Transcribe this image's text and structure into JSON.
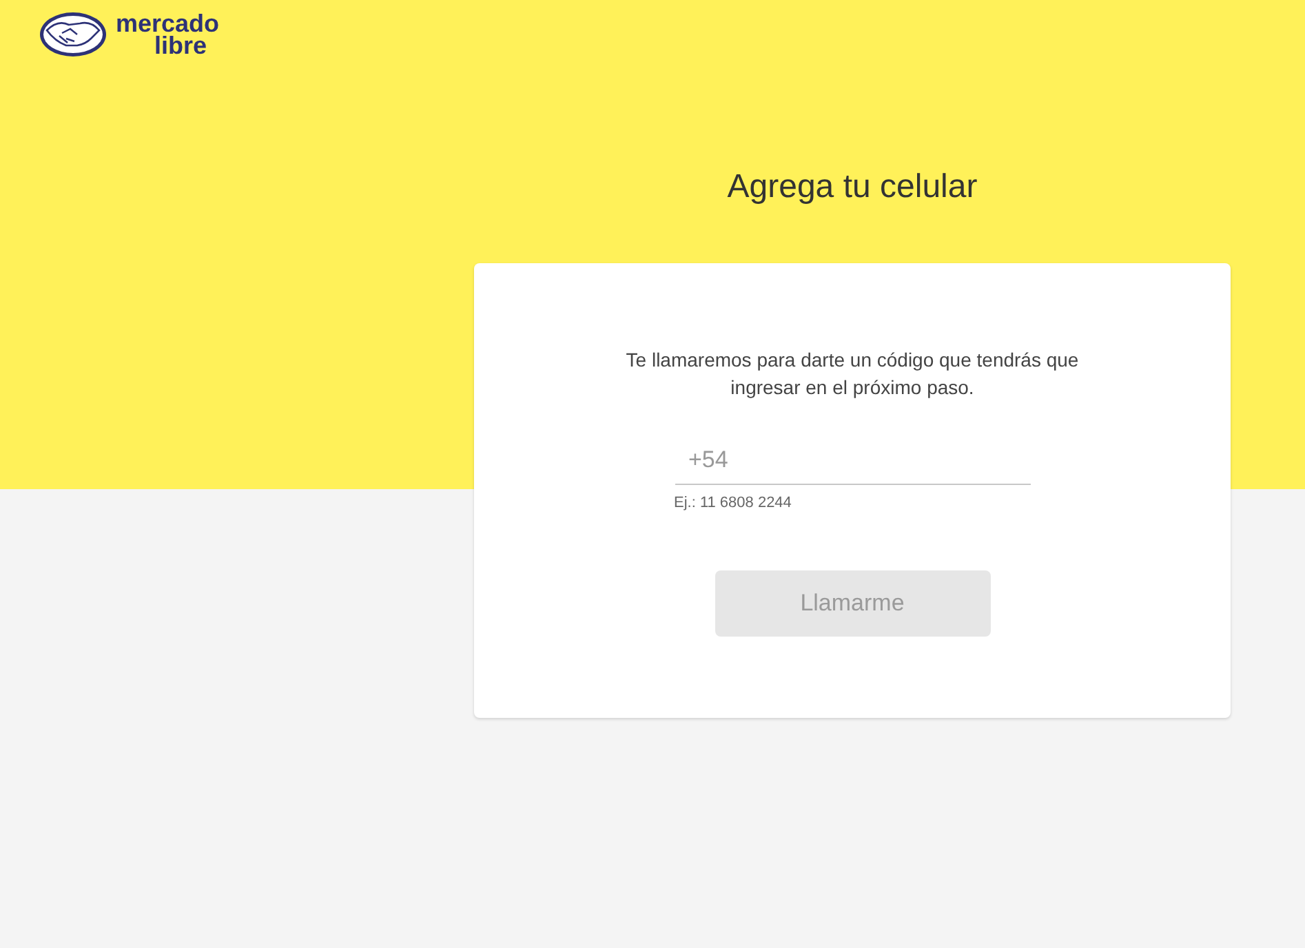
{
  "header": {
    "logo": {
      "line_1": "mercado",
      "line_2": "libre"
    }
  },
  "title": "Agrega tu celular",
  "card": {
    "description": "Te llamaremos para darte un código que tendrás que ingresar en el próximo paso.",
    "phone_field": {
      "prefix": "+54",
      "hint": "Ej.: 11 6808 2244"
    },
    "call_button": {
      "label": "Llamarme",
      "disabled": true
    }
  }
}
